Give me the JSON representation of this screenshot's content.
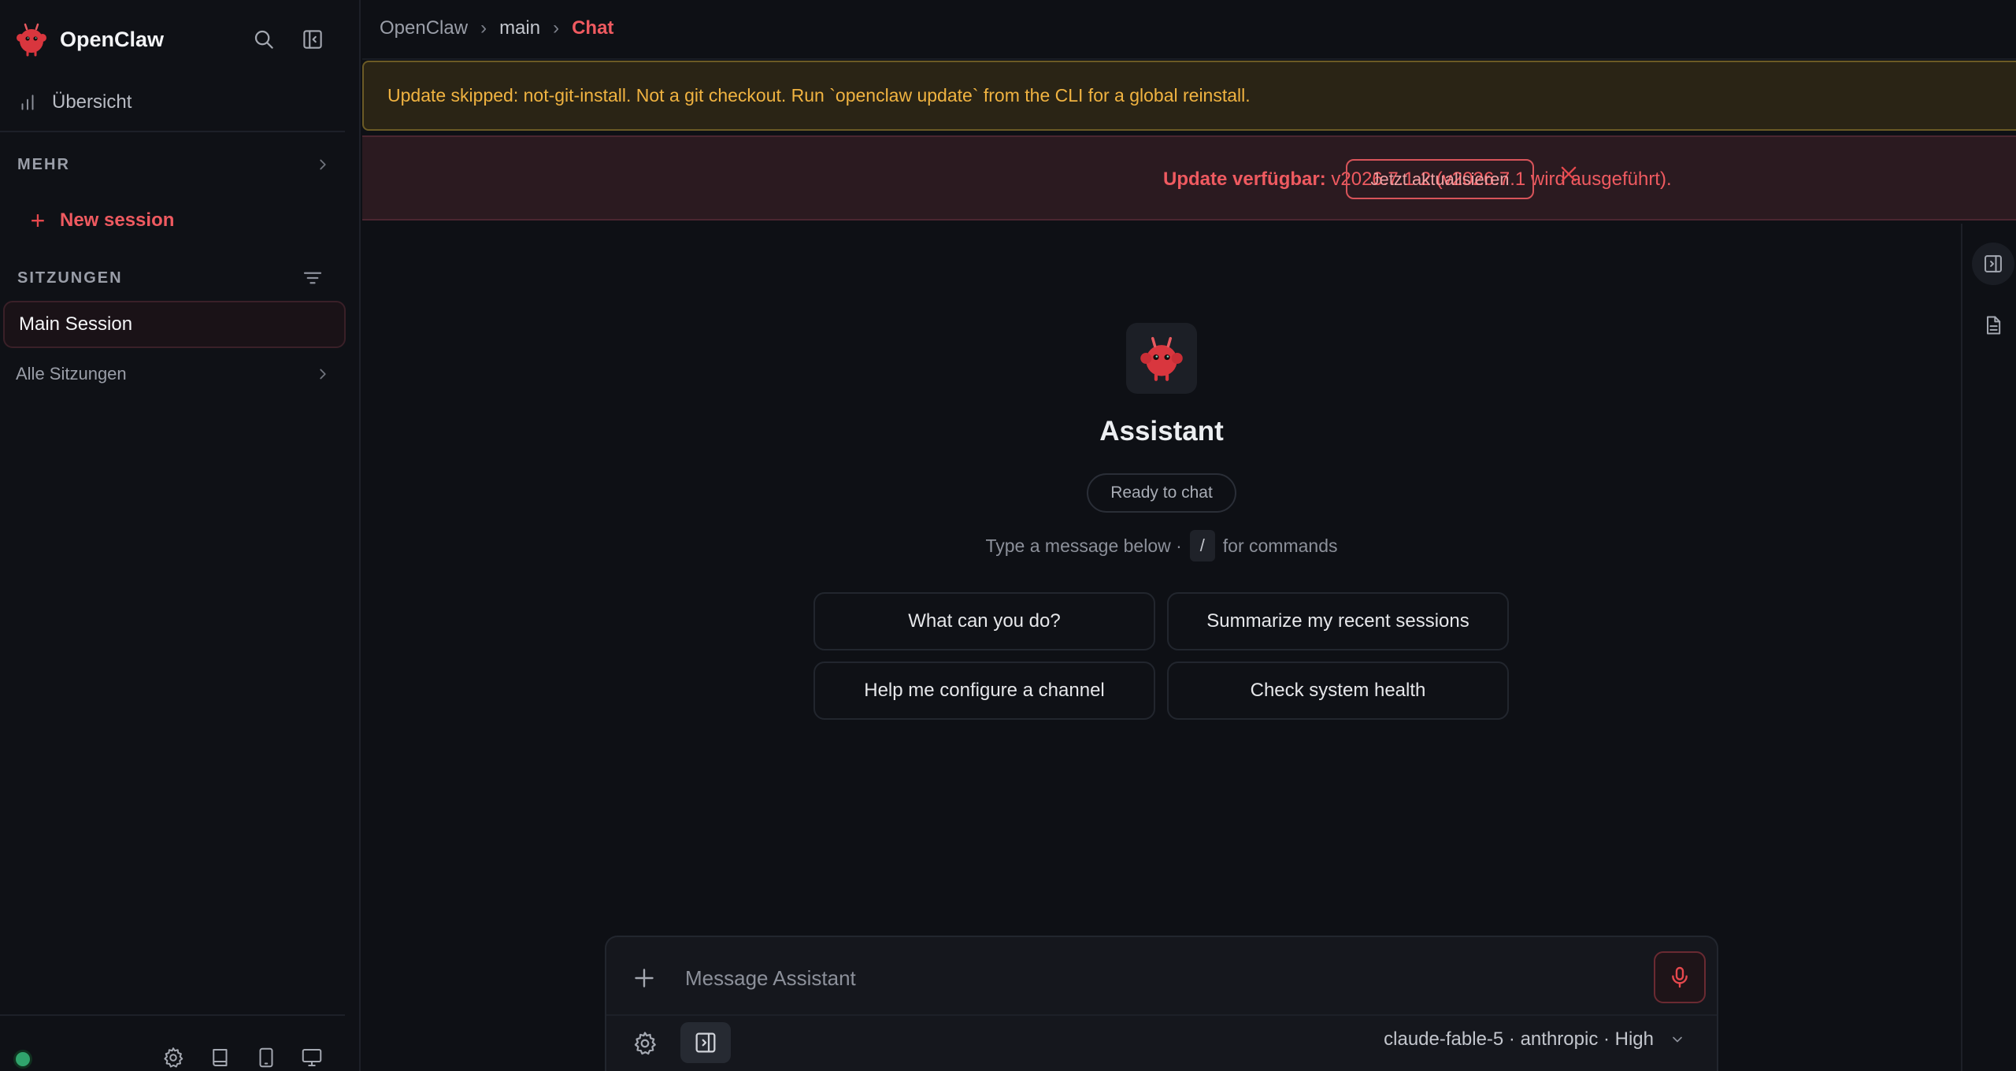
{
  "sidebar": {
    "brand": "OpenClaw",
    "nav": {
      "overview": "Übersicht"
    },
    "more_label": "MEHR",
    "new_session_label": "New session",
    "sessions_label": "SITZUNGEN",
    "main_session": "Main Session",
    "all_sessions": "Alle Sitzungen",
    "status": "online",
    "footer_icons": [
      "settings-icon",
      "book-icon",
      "tablet-icon",
      "monitor-icon"
    ]
  },
  "breadcrumb": {
    "root": "OpenClaw",
    "agent": "main",
    "page": "Chat"
  },
  "warning_banner": {
    "text": "Update skipped: not-git-install. Not a git checkout. Run `openclaw update` from the CLI for a global reinstall."
  },
  "update_banner": {
    "label": "Update verfügbar:",
    "detail": "v2026.7.1-2 (v2026.7.1 wird ausgeführt).",
    "button": "Jetzt aktualisieren"
  },
  "welcome": {
    "title": "Assistant",
    "status_pill": "Ready to chat",
    "hint_prefix": "Type a message below ·",
    "hint_key": "/",
    "hint_suffix": "for commands",
    "suggestions": [
      "What can you do?",
      "Summarize my recent sessions",
      "Help me configure a channel",
      "Check system health"
    ]
  },
  "composer": {
    "placeholder": "Message Assistant",
    "value": "",
    "model": "claude-fable-5 · anthropic · High"
  },
  "colors": {
    "accent": "#ef5a60",
    "warning": "#f0b341",
    "background": "#0e1015",
    "status_online": "#30a46c"
  }
}
